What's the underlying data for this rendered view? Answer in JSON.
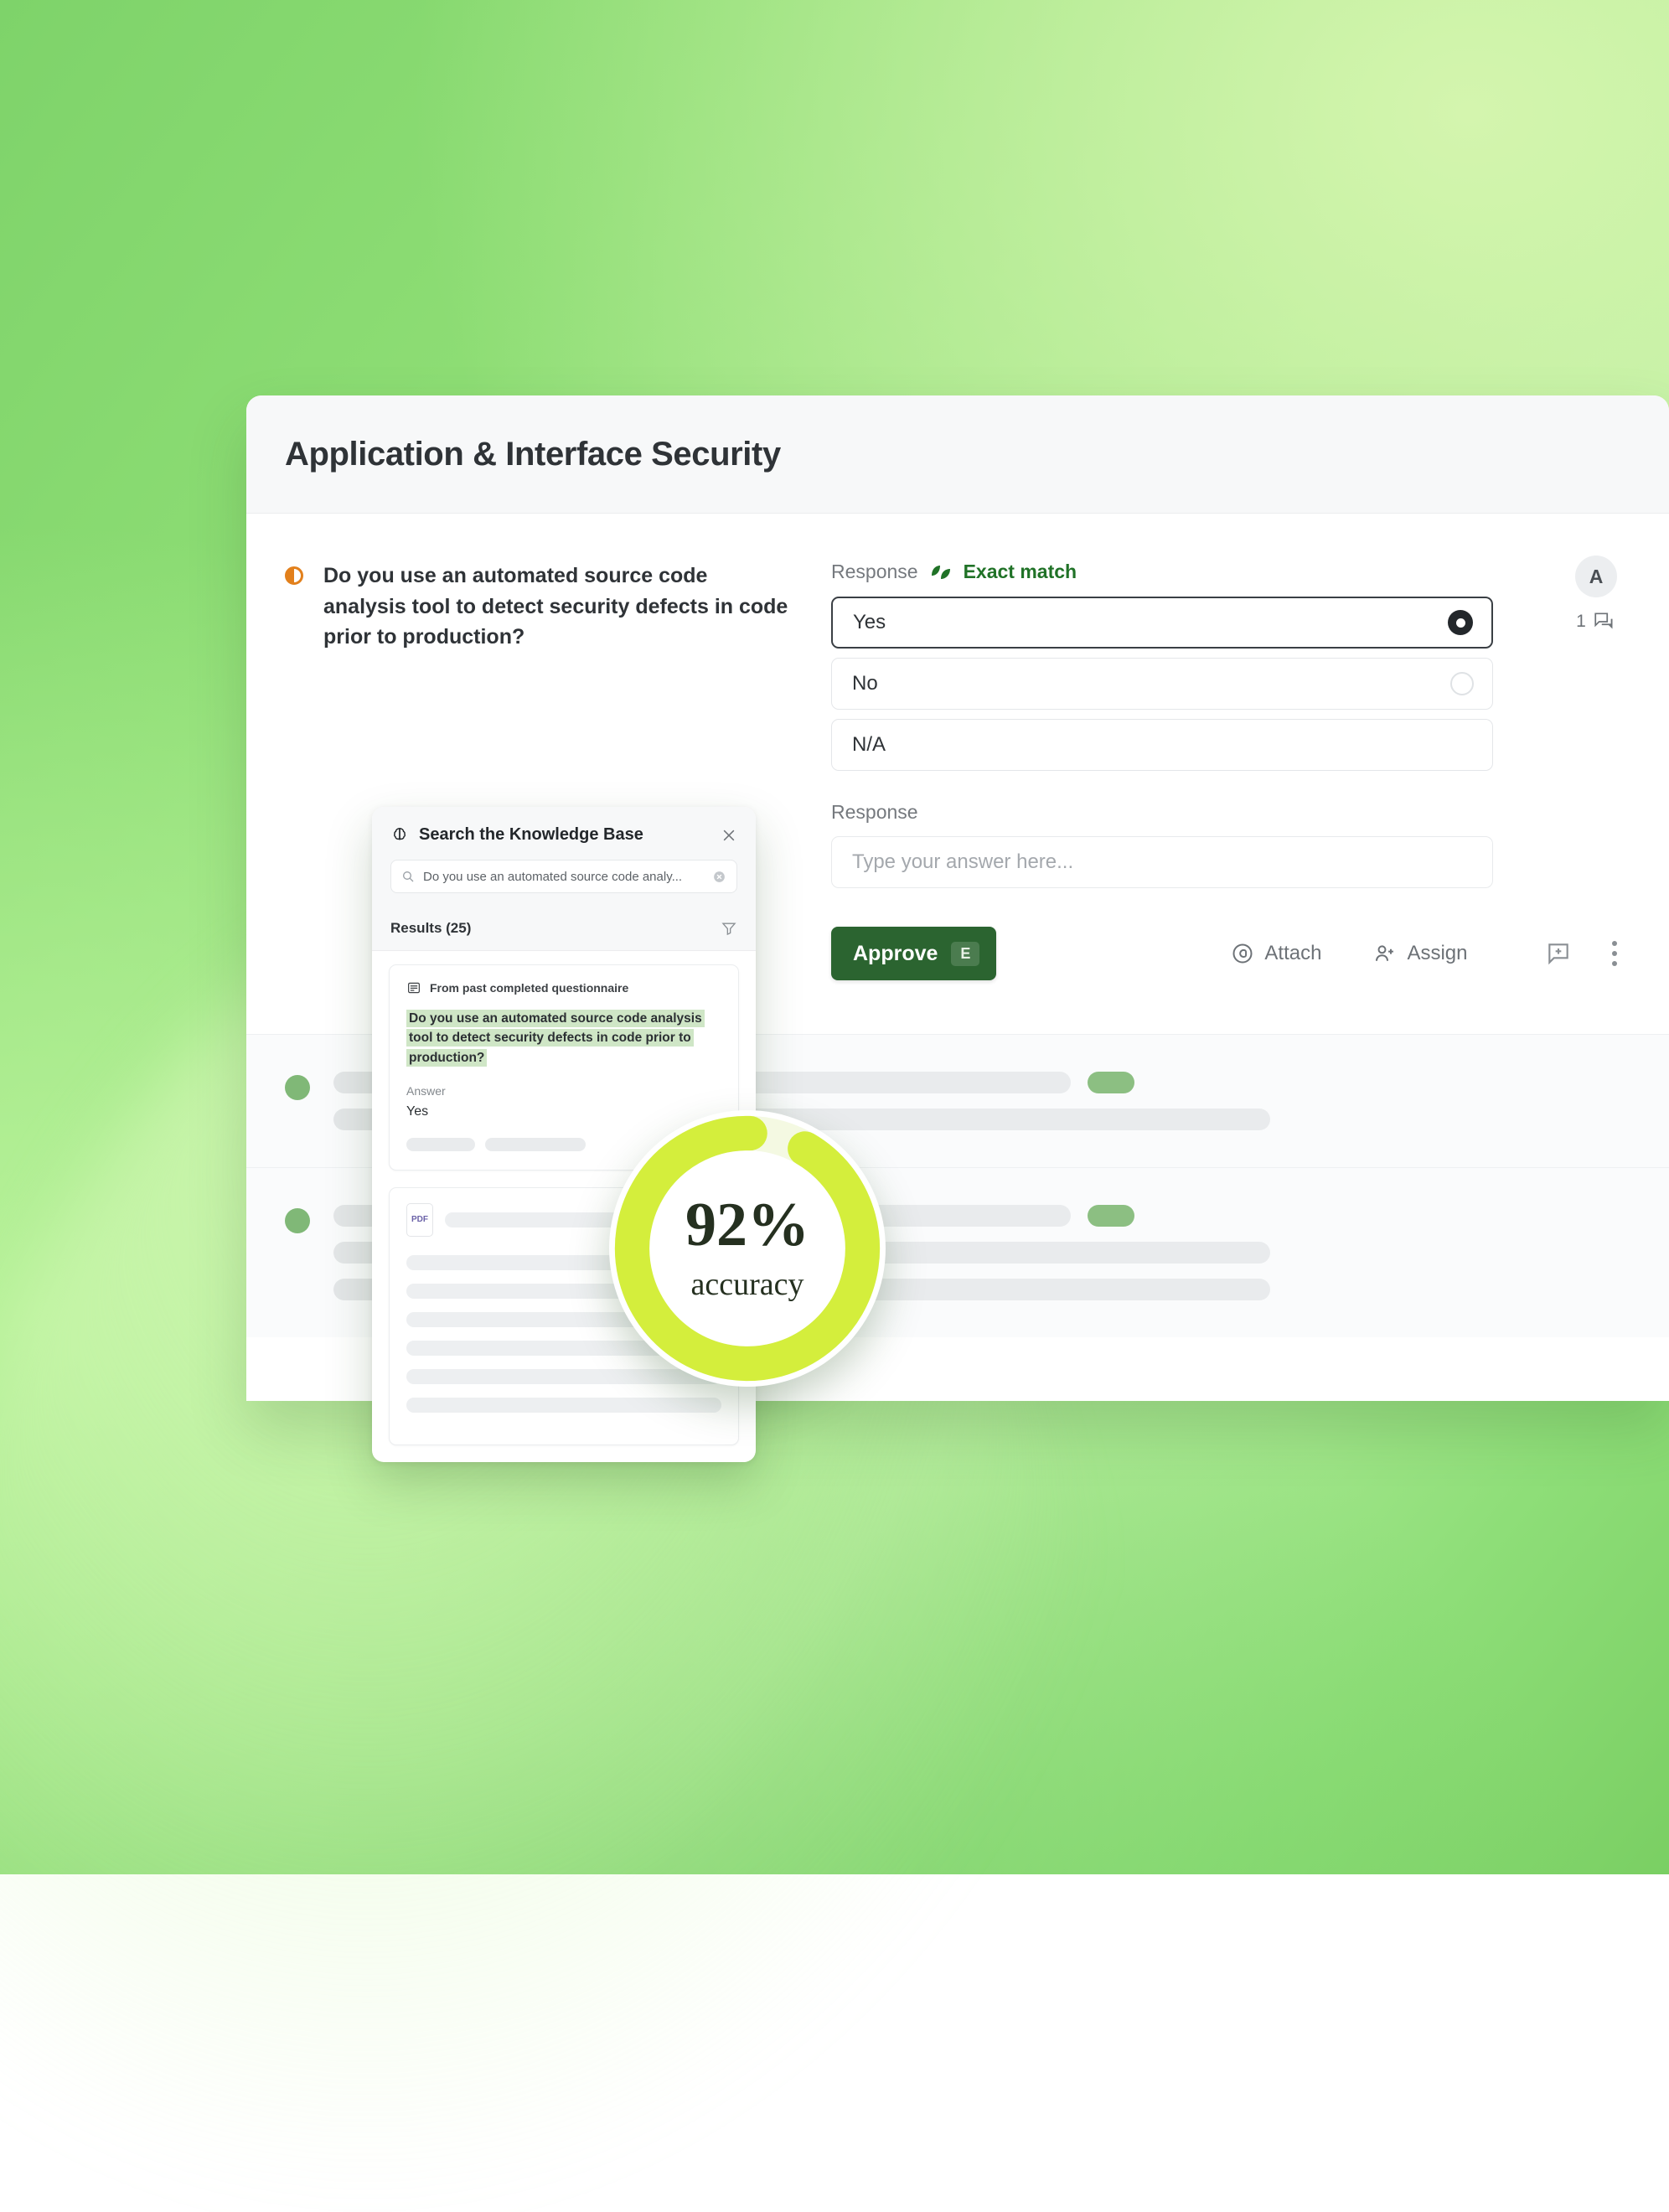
{
  "theme": {
    "accent_green": "#2b6430",
    "lime": "#d4ee3c",
    "status_orange": "#e2801c",
    "highlight_green": "#cfe6c6"
  },
  "panel": {
    "title": "Application & Interface Security"
  },
  "question": {
    "status_icon": "half-circle-icon",
    "text": "Do you use an automated source code analysis tool to detect security defects in code prior to production?"
  },
  "answer": {
    "response_label": "Response",
    "match_icon": "leaf-icon",
    "match_label": "Exact match",
    "options": [
      {
        "label": "Yes",
        "selected": true
      },
      {
        "label": "No",
        "selected": false
      },
      {
        "label": "N/A",
        "selected": false
      }
    ],
    "response2_label": "Response",
    "input_placeholder": "Type your answer here..."
  },
  "actions": {
    "approve_label": "Approve",
    "approve_shortcut": "E",
    "attach_label": "Attach",
    "assign_label": "Assign",
    "add_comment_icon": "add-comment-icon",
    "more_icon": "more-vertical-icon"
  },
  "meta": {
    "avatar_initial": "A",
    "comment_count": "1",
    "comment_icon": "comments-icon"
  },
  "knowledge_base": {
    "icon": "brain-icon",
    "title": "Search the Knowledge Base",
    "close_icon": "close-icon",
    "search_icon": "search-icon",
    "search_value": "Do you use an automated source code analy...",
    "clear_icon": "clear-circle-icon",
    "results_label": "Results (25)",
    "filter_icon": "filter-icon",
    "results": [
      {
        "source_icon": "document-icon",
        "source_label": "From past completed questionnaire",
        "question": "Do you use an automated source code analysis tool to detect security defects in code prior to production?",
        "answer_label": "Answer",
        "answer_value": "Yes"
      },
      {
        "file_badge": "PDF"
      }
    ]
  },
  "accuracy": {
    "value": "92%",
    "label": "accuracy",
    "percent": 92
  },
  "chart_data": {
    "type": "pie",
    "title": "92% accuracy",
    "categories": [
      "accuracy",
      "remaining"
    ],
    "values": [
      92,
      8
    ],
    "colors": [
      "#d4ee3c",
      "#f2f7de"
    ],
    "legend": "none",
    "annotations": [
      "92%",
      "accuracy"
    ]
  }
}
